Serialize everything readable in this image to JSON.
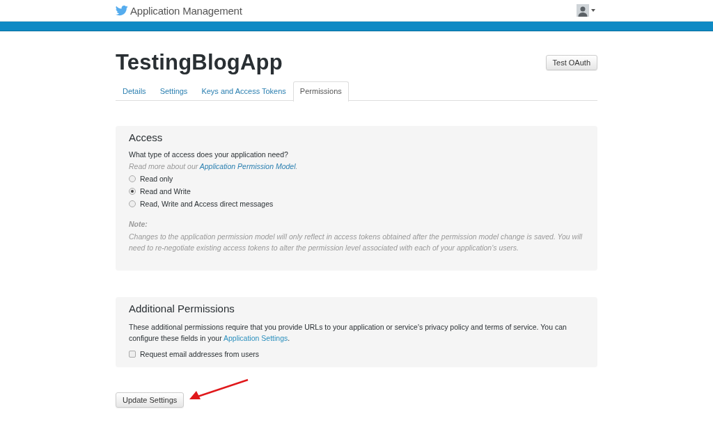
{
  "header": {
    "title": "Application Management"
  },
  "app": {
    "name": "TestingBlogApp",
    "test_button": "Test OAuth"
  },
  "tabs": [
    {
      "label": "Details",
      "selected": false
    },
    {
      "label": "Settings",
      "selected": false
    },
    {
      "label": "Keys and Access Tokens",
      "selected": false
    },
    {
      "label": "Permissions",
      "selected": true
    }
  ],
  "access": {
    "heading": "Access",
    "question": "What type of access does your application need?",
    "read_more": {
      "before": "Read more about our ",
      "link": "Application Permission Model",
      "after": "."
    },
    "options": [
      {
        "label": "Read only",
        "selected": false
      },
      {
        "label": "Read and Write",
        "selected": true
      },
      {
        "label": "Read, Write and Access direct messages",
        "selected": false
      }
    ],
    "note_label": "Note:",
    "note": "Changes to the application permission model will only reflect in access tokens obtained after the permission model change is saved. You will need to re-negotiate existing access tokens to alter the permission level associated with each of your application's users."
  },
  "additional": {
    "heading": "Additional Permissions",
    "text": {
      "before": "These additional permissions require that you provide URLs to your application or service's privacy policy and terms of service. You can configure these fields in your ",
      "link": "Application Settings",
      "after": "."
    },
    "checkbox": {
      "label": "Request email addresses from users",
      "checked": false
    }
  },
  "submit": "Update Settings"
}
